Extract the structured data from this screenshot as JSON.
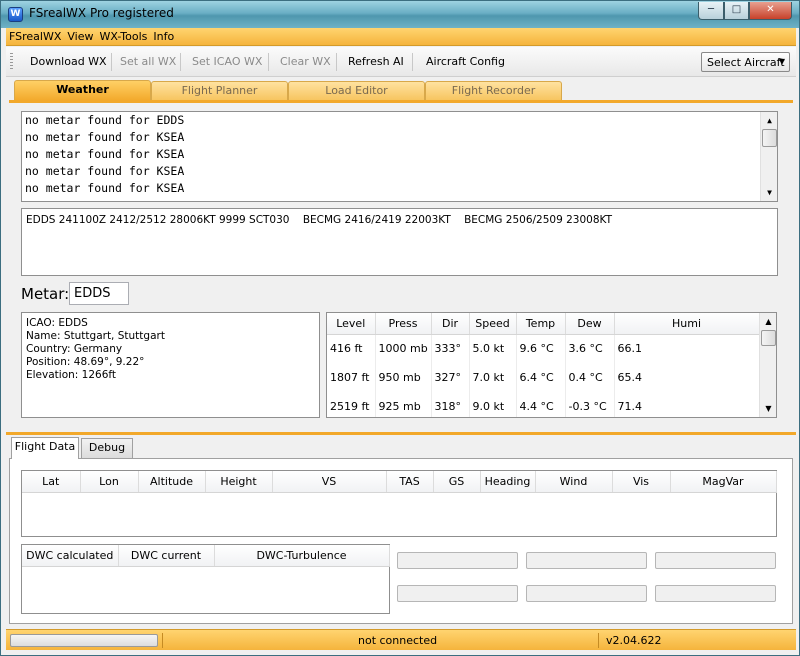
{
  "window": {
    "title": "FSrealWX Pro registered",
    "controls": {
      "minimize": "─",
      "maximize": "□",
      "close": "✕"
    }
  },
  "menu": [
    "FSrealWX",
    "View",
    "WX-Tools",
    "Info"
  ],
  "toolbar": {
    "download": "Download WX",
    "set_all": "Set all WX",
    "set_icao": "Set ICAO WX",
    "clear": "Clear WX",
    "refresh_ai": "Refresh AI",
    "aircraft_config": "Aircraft Config",
    "select_aircraft": "Select Aircraft"
  },
  "tabs": [
    "Weather",
    "Flight Planner",
    "Load Editor",
    "Flight Recorder"
  ],
  "log": [
    "no metar found for EDDS",
    "no metar found for KSEA",
    "no metar found for KSEA",
    "no metar found for KSEA",
    "no metar found for KSEA"
  ],
  "taf": "EDDS 241100Z 2412/2512 28006KT 9999 SCT030    BECMG 2416/2419 22003KT    BECMG 2506/2509 23008KT",
  "metar": {
    "label": "Metar:",
    "value": "EDDS"
  },
  "station": {
    "icao": "ICAO: EDDS",
    "name": "Name: Stuttgart, Stuttgart",
    "country": "Country: Germany",
    "position": "Position: 48.69°, 9.22°",
    "elevation": "Elevation: 1266ft"
  },
  "weather_grid": {
    "columns": [
      "Level",
      "Press",
      "Dir",
      "Speed",
      "Temp",
      "Dew",
      "Humi"
    ],
    "rows": [
      [
        "416 ft",
        "1000 mb",
        "333°",
        "5.0 kt",
        "9.6 °C",
        "3.6 °C",
        "66.1"
      ],
      [
        "1807 ft",
        "950 mb",
        "327°",
        "7.0 kt",
        "6.4 °C",
        "0.4 °C",
        "65.4"
      ],
      [
        "2519 ft",
        "925 mb",
        "318°",
        "9.0 kt",
        "4.4 °C",
        "-0.3 °C",
        "71.4"
      ]
    ]
  },
  "bottom_tabs": [
    "Flight Data",
    "Debug"
  ],
  "flight_data_columns": [
    "Lat",
    "Lon",
    "Altitude",
    "Height",
    "VS",
    "TAS",
    "GS",
    "Heading",
    "Wind",
    "Vis",
    "MagVar"
  ],
  "dwc_columns": [
    "DWC calculated",
    "DWC current",
    "DWC-Turbulence"
  ],
  "status": {
    "text": "not connected",
    "version": "v2.04.622"
  }
}
